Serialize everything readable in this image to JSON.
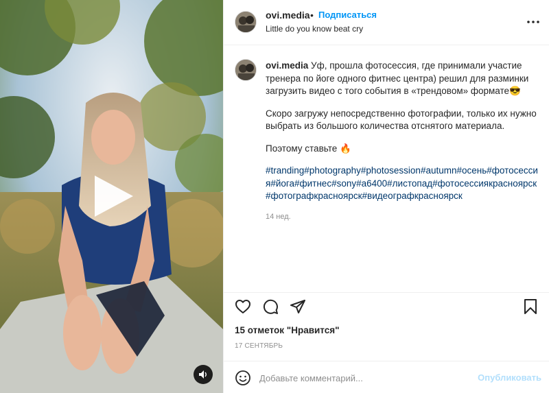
{
  "header": {
    "username": "ovi.media",
    "dot": "•",
    "follow_label": "Подписаться",
    "subtitle": "Little do you know beat cry"
  },
  "caption": {
    "username": "ovi.media",
    "text1": "Уф, прошла фотосессия, где принимали участие тренера по йоге одного фитнес центра) решил для разминки загрузить видео с того события в «трендовом» формате😎",
    "text2": "Скоро загружу непосредственно фотографии, только их нужно выбрать из большого количества отснятого материала.",
    "text3": "Поэтому ставьте 🔥",
    "hashtags": [
      "#tranding",
      "#photography",
      "#photosession",
      "#autumn",
      "#осень",
      "#фотосессия",
      "#йога",
      "#фитнес",
      "#sony",
      "#a6400",
      "#листопад",
      "#фотосессиякрасноярск",
      "#фотографкрасноярск",
      "#видеографкрасноярск"
    ],
    "age": "14 нед."
  },
  "likes": "15 отметок \"Нравится\"",
  "date": "17 СЕНТЯБРЬ",
  "comment": {
    "placeholder": "Добавьте комментарий...",
    "publish_label": "Опубликовать"
  },
  "icons": {
    "like": "heart-icon",
    "comment": "comment-icon",
    "share": "share-icon",
    "save": "bookmark-icon",
    "emoji": "smiley-icon",
    "more": "more-horizontal-icon",
    "play": "play-icon",
    "sound": "speaker-icon"
  },
  "colors": {
    "accent": "#0095f6",
    "link": "#00376b",
    "publish_disabled": "#b2dffc",
    "muted": "#8e8e8e"
  }
}
